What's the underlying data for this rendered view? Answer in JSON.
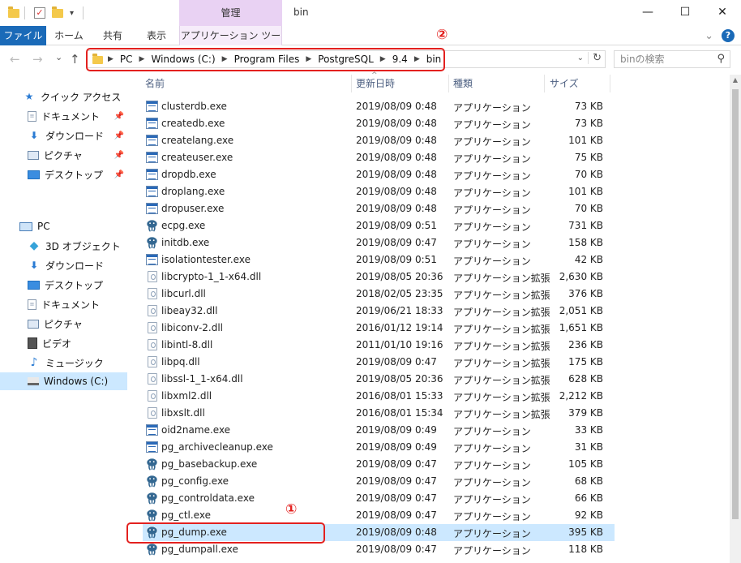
{
  "window": {
    "title": "bin",
    "context_group": "管理",
    "minimize": "—",
    "maximize": "☐",
    "close": "✕"
  },
  "ribbon": {
    "tabs": [
      "ファイル",
      "ホーム",
      "共有",
      "表示",
      "アプリケーション ツール"
    ],
    "expand": "⌄",
    "help": "?"
  },
  "nav_buttons": {
    "back": "←",
    "forward": "→",
    "recent": "⌄",
    "up": "↑"
  },
  "address": {
    "crumbs": [
      "PC",
      "Windows (C:)",
      "Program Files",
      "PostgreSQL",
      "9.4",
      "bin"
    ],
    "refresh": "↻",
    "dropdown": "⌄"
  },
  "search": {
    "placeholder": "binの検索",
    "icon": "search-icon"
  },
  "annotations": [
    "②",
    "①"
  ],
  "sidebar": {
    "quick_access": [
      {
        "label": "クイック アクセス",
        "icon": "star-icon"
      },
      {
        "label": "ドキュメント",
        "icon": "document-icon",
        "pinned": true
      },
      {
        "label": "ダウンロード",
        "icon": "download-icon",
        "pinned": true
      },
      {
        "label": "ピクチャ",
        "icon": "pictures-icon",
        "pinned": true
      },
      {
        "label": "デスクトップ",
        "icon": "desktop-icon",
        "pinned": true
      }
    ],
    "pc": [
      {
        "label": "PC",
        "icon": "computer-icon"
      },
      {
        "label": "3D オブジェクト",
        "icon": "cube-icon"
      },
      {
        "label": "ダウンロード",
        "icon": "download-icon"
      },
      {
        "label": "デスクトップ",
        "icon": "desktop-icon"
      },
      {
        "label": "ドキュメント",
        "icon": "document-icon"
      },
      {
        "label": "ピクチャ",
        "icon": "pictures-icon"
      },
      {
        "label": "ビデオ",
        "icon": "video-icon"
      },
      {
        "label": "ミュージック",
        "icon": "music-icon"
      },
      {
        "label": "Windows (C:)",
        "icon": "drive-icon",
        "selected": true
      }
    ]
  },
  "columns": [
    "名前",
    "更新日時",
    "種類",
    "サイズ"
  ],
  "files": [
    {
      "name": "clusterdb.exe",
      "date": "2019/08/09 0:48",
      "type": "アプリケーション",
      "size": "73 KB",
      "icon": "exe"
    },
    {
      "name": "createdb.exe",
      "date": "2019/08/09 0:48",
      "type": "アプリケーション",
      "size": "73 KB",
      "icon": "exe"
    },
    {
      "name": "createlang.exe",
      "date": "2019/08/09 0:48",
      "type": "アプリケーション",
      "size": "101 KB",
      "icon": "exe"
    },
    {
      "name": "createuser.exe",
      "date": "2019/08/09 0:48",
      "type": "アプリケーション",
      "size": "75 KB",
      "icon": "exe"
    },
    {
      "name": "dropdb.exe",
      "date": "2019/08/09 0:48",
      "type": "アプリケーション",
      "size": "70 KB",
      "icon": "exe"
    },
    {
      "name": "droplang.exe",
      "date": "2019/08/09 0:48",
      "type": "アプリケーション",
      "size": "101 KB",
      "icon": "exe"
    },
    {
      "name": "dropuser.exe",
      "date": "2019/08/09 0:48",
      "type": "アプリケーション",
      "size": "70 KB",
      "icon": "exe"
    },
    {
      "name": "ecpg.exe",
      "date": "2019/08/09 0:51",
      "type": "アプリケーション",
      "size": "731 KB",
      "icon": "pg"
    },
    {
      "name": "initdb.exe",
      "date": "2019/08/09 0:47",
      "type": "アプリケーション",
      "size": "158 KB",
      "icon": "pg"
    },
    {
      "name": "isolationtester.exe",
      "date": "2019/08/09 0:51",
      "type": "アプリケーション",
      "size": "42 KB",
      "icon": "exe"
    },
    {
      "name": "libcrypto-1_1-x64.dll",
      "date": "2019/08/05 20:36",
      "type": "アプリケーション拡張",
      "size": "2,630 KB",
      "icon": "dll"
    },
    {
      "name": "libcurl.dll",
      "date": "2018/02/05 23:35",
      "type": "アプリケーション拡張",
      "size": "376 KB",
      "icon": "dll"
    },
    {
      "name": "libeay32.dll",
      "date": "2019/06/21 18:33",
      "type": "アプリケーション拡張",
      "size": "2,051 KB",
      "icon": "dll"
    },
    {
      "name": "libiconv-2.dll",
      "date": "2016/01/12 19:14",
      "type": "アプリケーション拡張",
      "size": "1,651 KB",
      "icon": "dll"
    },
    {
      "name": "libintl-8.dll",
      "date": "2011/01/10 19:16",
      "type": "アプリケーション拡張",
      "size": "236 KB",
      "icon": "dll"
    },
    {
      "name": "libpq.dll",
      "date": "2019/08/09 0:47",
      "type": "アプリケーション拡張",
      "size": "175 KB",
      "icon": "dll"
    },
    {
      "name": "libssl-1_1-x64.dll",
      "date": "2019/08/05 20:36",
      "type": "アプリケーション拡張",
      "size": "628 KB",
      "icon": "dll"
    },
    {
      "name": "libxml2.dll",
      "date": "2016/08/01 15:33",
      "type": "アプリケーション拡張",
      "size": "2,212 KB",
      "icon": "dll"
    },
    {
      "name": "libxslt.dll",
      "date": "2016/08/01 15:34",
      "type": "アプリケーション拡張",
      "size": "379 KB",
      "icon": "dll"
    },
    {
      "name": "oid2name.exe",
      "date": "2019/08/09 0:49",
      "type": "アプリケーション",
      "size": "33 KB",
      "icon": "exe"
    },
    {
      "name": "pg_archivecleanup.exe",
      "date": "2019/08/09 0:49",
      "type": "アプリケーション",
      "size": "31 KB",
      "icon": "exe"
    },
    {
      "name": "pg_basebackup.exe",
      "date": "2019/08/09 0:47",
      "type": "アプリケーション",
      "size": "105 KB",
      "icon": "pg"
    },
    {
      "name": "pg_config.exe",
      "date": "2019/08/09 0:47",
      "type": "アプリケーション",
      "size": "68 KB",
      "icon": "pg"
    },
    {
      "name": "pg_controldata.exe",
      "date": "2019/08/09 0:47",
      "type": "アプリケーション",
      "size": "66 KB",
      "icon": "pg"
    },
    {
      "name": "pg_ctl.exe",
      "date": "2019/08/09 0:47",
      "type": "アプリケーション",
      "size": "92 KB",
      "icon": "pg"
    },
    {
      "name": "pg_dump.exe",
      "date": "2019/08/09 0:48",
      "type": "アプリケーション",
      "size": "395 KB",
      "icon": "pg",
      "selected": true
    },
    {
      "name": "pg_dumpall.exe",
      "date": "2019/08/09 0:47",
      "type": "アプリケーション",
      "size": "118 KB",
      "icon": "pg"
    }
  ],
  "colors": {
    "file_tab": "#1a6ab8",
    "context_tab": "#e9d2f3",
    "selection": "#cce8ff",
    "annotation": "#e3211f"
  }
}
